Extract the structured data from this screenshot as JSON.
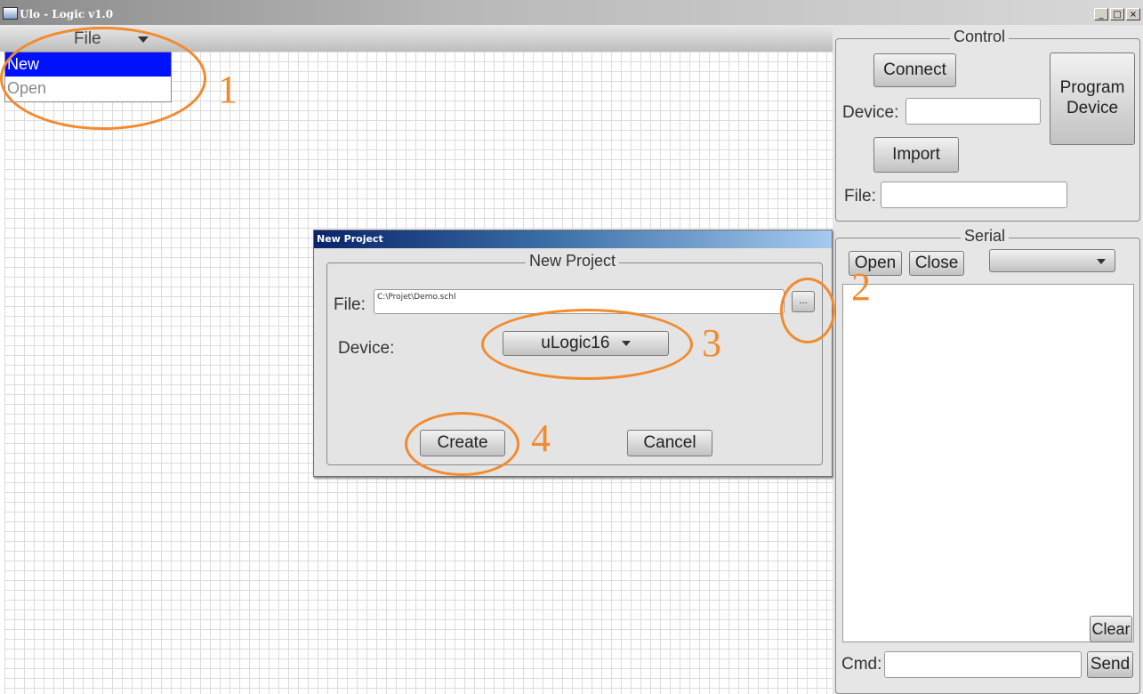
{
  "window": {
    "title": "Ulo - Logic v1.0",
    "min_glyph": "_",
    "max_glyph": "□",
    "close_glyph": "×"
  },
  "menu": {
    "file_label": "File",
    "items": [
      {
        "label": "New"
      },
      {
        "label": "Open"
      }
    ]
  },
  "control": {
    "title": "Control",
    "connect_label": "Connect",
    "device_label": "Device:",
    "device_value": "",
    "program_label": "Program Device",
    "import_label": "Import",
    "file_label": "File:",
    "file_value": ""
  },
  "serial": {
    "title": "Serial",
    "open_label": "Open",
    "close_label": "Close",
    "port_value": "",
    "clear_label": "Clear",
    "cmd_label": "Cmd:",
    "cmd_value": "",
    "send_label": "Send"
  },
  "dialog": {
    "window_title": "New Project",
    "group_title": "New Project",
    "file_label": "File:",
    "file_value": "C:\\Projet\\Demo.schl",
    "browse_label": "...",
    "device_label": "Device:",
    "device_value": "uLogic16",
    "create_label": "Create",
    "cancel_label": "Cancel"
  },
  "annotations": [
    "1",
    "2",
    "3",
    "4"
  ],
  "colors": {
    "highlight": "#0011ff",
    "annotation": "#f28a2e",
    "dialog_titlebar": "#0a246a"
  }
}
